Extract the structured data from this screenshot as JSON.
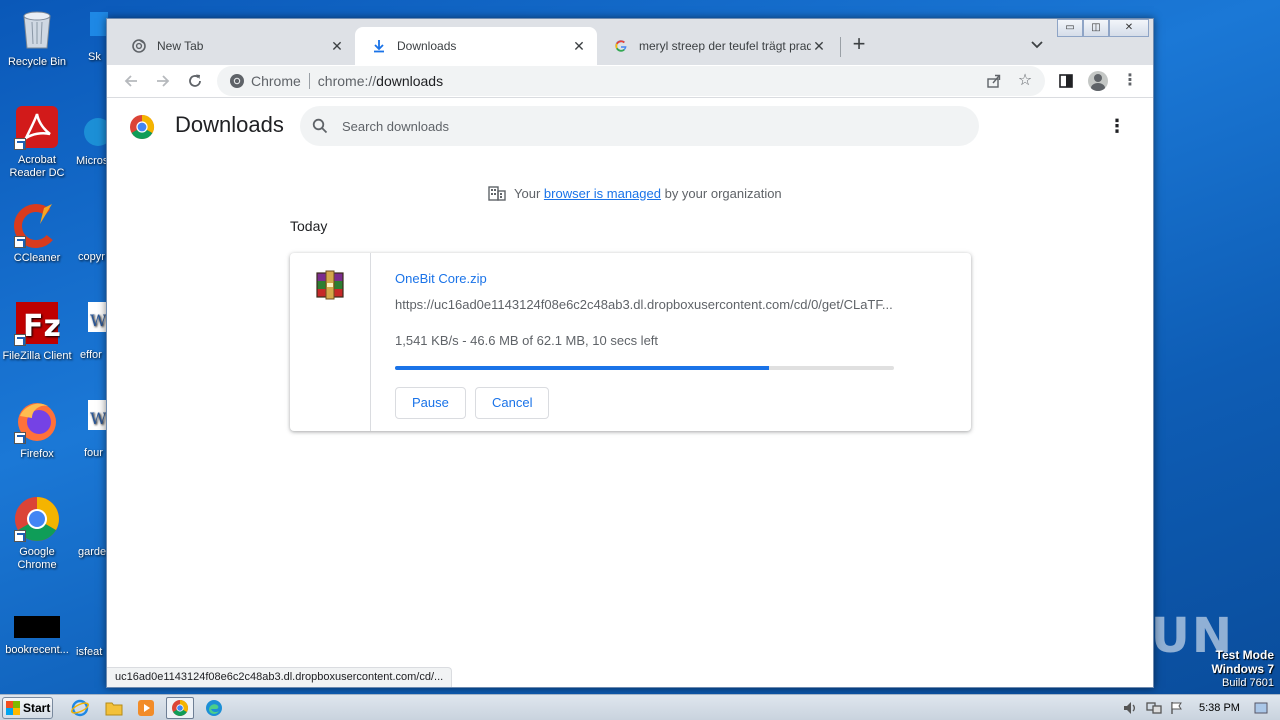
{
  "desktop": {
    "icons": [
      {
        "label": "Recycle Bin"
      },
      {
        "label": "Acrobat Reader DC"
      },
      {
        "label": "CCleaner"
      },
      {
        "label": "FileZilla Client"
      },
      {
        "label": "Firefox"
      },
      {
        "label": "Google Chrome"
      },
      {
        "label": "bookrecent..."
      }
    ],
    "partial_labels": [
      "Sk",
      "Micros",
      "copyr",
      "effor",
      "four",
      "garde",
      "isfeat"
    ],
    "watermark": "ANY RUN",
    "test_mode": {
      "line1": "Test Mode",
      "line2": "Windows 7",
      "line3": "Build 7601"
    }
  },
  "browser": {
    "tabs": [
      {
        "title": "New Tab",
        "icon": "chrome-icon",
        "active": false
      },
      {
        "title": "Downloads",
        "icon": "download-icon",
        "active": true
      },
      {
        "title": "meryl streep der teufel trägt prada -",
        "icon": "google-icon",
        "active": false
      }
    ],
    "new_tab_label": "+",
    "omnibox": {
      "site_label": "Chrome",
      "url_scheme": "chrome://",
      "url_path": "downloads"
    },
    "status_bubble": "uc16ad0e1143124f08e6c2c48ab3.dl.dropboxusercontent.com/cd/..."
  },
  "downloads_page": {
    "title": "Downloads",
    "search_placeholder": "Search downloads",
    "managed": {
      "prefix": "Your",
      "link": "browser is managed",
      "suffix": "by your organization"
    },
    "section_label": "Today",
    "items": [
      {
        "file_name": "OneBit Core.zip",
        "url": "https://uc16ad0e1143124f08e6c2c48ab3.dl.dropboxusercontent.com/cd/0/get/CLaTF...",
        "status": "1,541 KB/s - 46.6 MB of 62.1 MB, 10 secs left",
        "progress_percent": 75,
        "pause_label": "Pause",
        "cancel_label": "Cancel"
      }
    ]
  },
  "taskbar": {
    "start_label": "Start",
    "clock": "5:38 PM",
    "pinned": [
      "internet-explorer-icon",
      "explorer-folder-icon",
      "media-player-icon",
      "chrome-icon",
      "edge-icon"
    ]
  },
  "colors": {
    "accent": "#1a73e8",
    "desktop": "#1565c0",
    "progress_track": "#e0e0e0"
  }
}
